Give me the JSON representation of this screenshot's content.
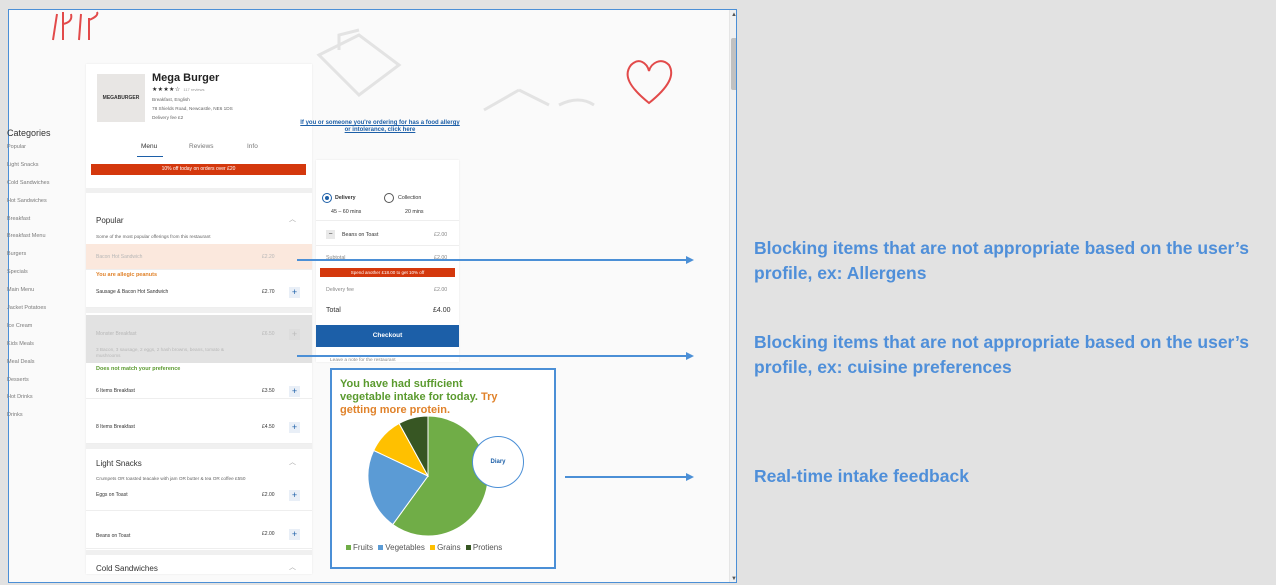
{
  "categories": {
    "title": "Categories",
    "items": [
      "Popular",
      "Light Snacks",
      "Cold Sandwiches",
      "Hot Sandwiches",
      "Breakfast",
      "Breakfast Menu",
      "Burgers",
      "Specials",
      "Main Menu",
      "Jacket Potatoes",
      "Ice Cream",
      "Kids Meals",
      "Meal Deals",
      "Desserts",
      "Hot Drinks",
      "Drinks"
    ]
  },
  "restaurant": {
    "logo_text": "MEGABURGER",
    "name": "Mega Burger",
    "stars": "★★★★☆",
    "reviews": "117 reviews",
    "cuisine": "Breakfast, English",
    "address": "78 Shields Road, Newcastle, NE6 1DS",
    "delivery_fee": "Delivery fee £2"
  },
  "tabs": [
    "Menu",
    "Reviews",
    "Info"
  ],
  "promo": "10% off today on orders over £20",
  "popular": {
    "title": "Popular",
    "desc": "Some of the most popular offerings from this restaurant",
    "items": [
      {
        "name": "Bacon Hot Sandwich",
        "price": "£2.20"
      },
      {
        "name": "Sausage & Bacon Hot Sandwich",
        "price": "£2.70"
      },
      {
        "name": "Monster Breakfast",
        "price": "£6.50",
        "desc": "3 Bacon, 3 sausage, 2 eggs, 2 hash browns, beans, tomato & mushrooms"
      },
      {
        "name": "6 Items Breakfast",
        "price": "£3.50"
      },
      {
        "name": "8 Items Breakfast",
        "price": "£4.50"
      }
    ],
    "warning_allergy": "You are allegic peanuts",
    "warning_pref": "Does not match your preference"
  },
  "light_snacks": {
    "title": "Light Snacks",
    "desc": "Crumpets OR toasted teacake with jam OR butter & tea OR coffee £550",
    "items": [
      {
        "name": "Eggs on Toast",
        "price": "£2.00"
      },
      {
        "name": "Beans on Toast",
        "price": "£2.00"
      }
    ]
  },
  "cold_sandwiches": {
    "title": "Cold Sandwiches"
  },
  "order": {
    "allergy_link": "If you or someone you're ordering for has a food allergy or intolerance, click here",
    "delivery_label": "Delivery",
    "delivery_time": "45 – 60 mins",
    "collection_label": "Collection",
    "collection_time": "20 mins",
    "line_item": "Beans on Toast",
    "line_price": "£2.00",
    "subtotal_label": "Subtotal",
    "subtotal_value": "£2.00",
    "spend_banner": "Spend another £18.00 to get 10% off",
    "delivery_fee_label": "Delivery fee",
    "delivery_fee_value": "£2.00",
    "total_label": "Total",
    "total_value": "£4.00",
    "checkout": "Checkout",
    "note": "Leave a note for the restaurant"
  },
  "intake": {
    "message_green": "You have had sufficient vegetable intake for today.",
    "message_orange": "Try getting more protein.",
    "diary_label": "Diary",
    "legend": [
      "Fruits",
      "Vegetables",
      "Grains",
      "Protiens"
    ]
  },
  "chart_data": {
    "type": "pie",
    "categories": [
      "Fruits",
      "Vegetables",
      "Grains",
      "Protiens"
    ],
    "values": [
      60,
      22,
      10,
      8
    ],
    "colors": [
      "#70ad47",
      "#5b9bd5",
      "#ffc000",
      "#375623"
    ]
  },
  "callouts": {
    "c1": "Blocking items that are not appropriate based on the user’s profile, ex: Allergens",
    "c2": "Blocking items that are not appropriate based on the user’s profile, ex: cuisine preferences",
    "c3": "Real-time intake feedback"
  },
  "colors": {
    "accent_blue": "#1c5fa8",
    "promo_red": "#d4380d",
    "callout_blue": "#4f8fd9",
    "warn_orange": "#e0822a",
    "warn_green": "#5a9a2e"
  }
}
